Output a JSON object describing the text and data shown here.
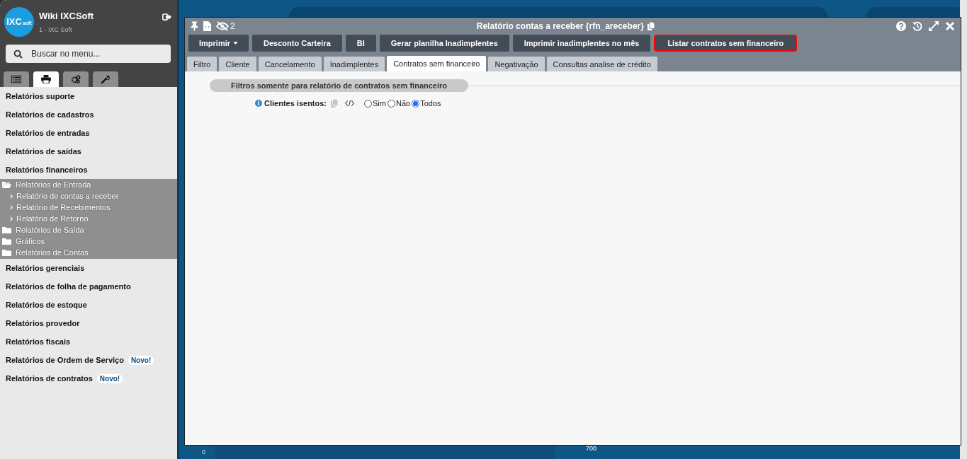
{
  "sidebar": {
    "title": "Wiki IXCSoft",
    "subtitle": "1 - IXC Soft",
    "logo": {
      "big": "IXC",
      "small": "soft"
    },
    "search": {
      "placeholder": "Buscar no menu..."
    },
    "tabs": [
      {
        "kind": "list",
        "selected": false
      },
      {
        "kind": "printer",
        "selected": true
      },
      {
        "kind": "gears",
        "selected": false
      },
      {
        "kind": "wrench",
        "selected": false
      }
    ],
    "items": [
      {
        "label": "Relatórios suporte"
      },
      {
        "label": "Relatórios de cadastros"
      },
      {
        "label": "Relatórios de entradas"
      },
      {
        "label": "Relatórios de saídas"
      },
      {
        "label": "Relatórios financeiros",
        "expanded": true,
        "children": [
          {
            "label": "Relatórios de Entrada",
            "expanded": true,
            "children": [
              {
                "label": "Relatório de contas a receber"
              },
              {
                "label": "Relatório de Recebimentos"
              },
              {
                "label": "Relatório de Retorno"
              }
            ]
          },
          {
            "label": "Relatórios de Saída",
            "expanded": false
          },
          {
            "label": "Gráficos",
            "expanded": false
          },
          {
            "label": "Relatórios de Contas",
            "expanded": false
          }
        ]
      },
      {
        "label": "Relatórios gerenciais"
      },
      {
        "label": "Relatórios de folha de pagamento"
      },
      {
        "label": "Relatórios de estoque"
      },
      {
        "label": "Relatórios provedor"
      },
      {
        "label": "Relatórios fiscais"
      },
      {
        "label": "Relatórios de Ordem de Serviço",
        "badge": "Novo!"
      },
      {
        "label": "Relatórios de contratos",
        "badge": "Novo!"
      }
    ]
  },
  "background": {
    "labels": [
      "0",
      "700"
    ]
  },
  "modal": {
    "title": "Relatório contas a receber {rfn_areceber}",
    "hidden_count": "2",
    "buttons": [
      {
        "label": "Imprimir",
        "dropdown": true,
        "highlighted": false
      },
      {
        "label": "Desconto Carteira",
        "dropdown": false,
        "highlighted": false
      },
      {
        "label": "BI",
        "dropdown": false,
        "highlighted": false
      },
      {
        "label": "Gerar planilha Inadimplentes",
        "dropdown": false,
        "highlighted": false
      },
      {
        "label": "Imprimir inadimplentes no mês",
        "dropdown": false,
        "highlighted": false
      },
      {
        "label": "Listar contratos sem financeiro",
        "dropdown": false,
        "highlighted": true
      }
    ],
    "tabs": [
      {
        "label": "Filtro",
        "selected": false
      },
      {
        "label": "Cliente",
        "selected": false
      },
      {
        "label": "Cancelamento",
        "selected": false
      },
      {
        "label": "Inadimplentes",
        "selected": false
      },
      {
        "label": "Contratos sem financeiro",
        "selected": true
      },
      {
        "label": "Negativação",
        "selected": false
      },
      {
        "label": "Consultas analise de crédito",
        "selected": false
      }
    ],
    "section_title": "Filtros somente para relatório de contratos sem financeiro",
    "field": {
      "label": "Clientes isentos:",
      "options": [
        {
          "label": "Sim",
          "selected": false
        },
        {
          "label": "Não",
          "selected": false
        },
        {
          "label": "Todos",
          "selected": true
        }
      ]
    }
  }
}
